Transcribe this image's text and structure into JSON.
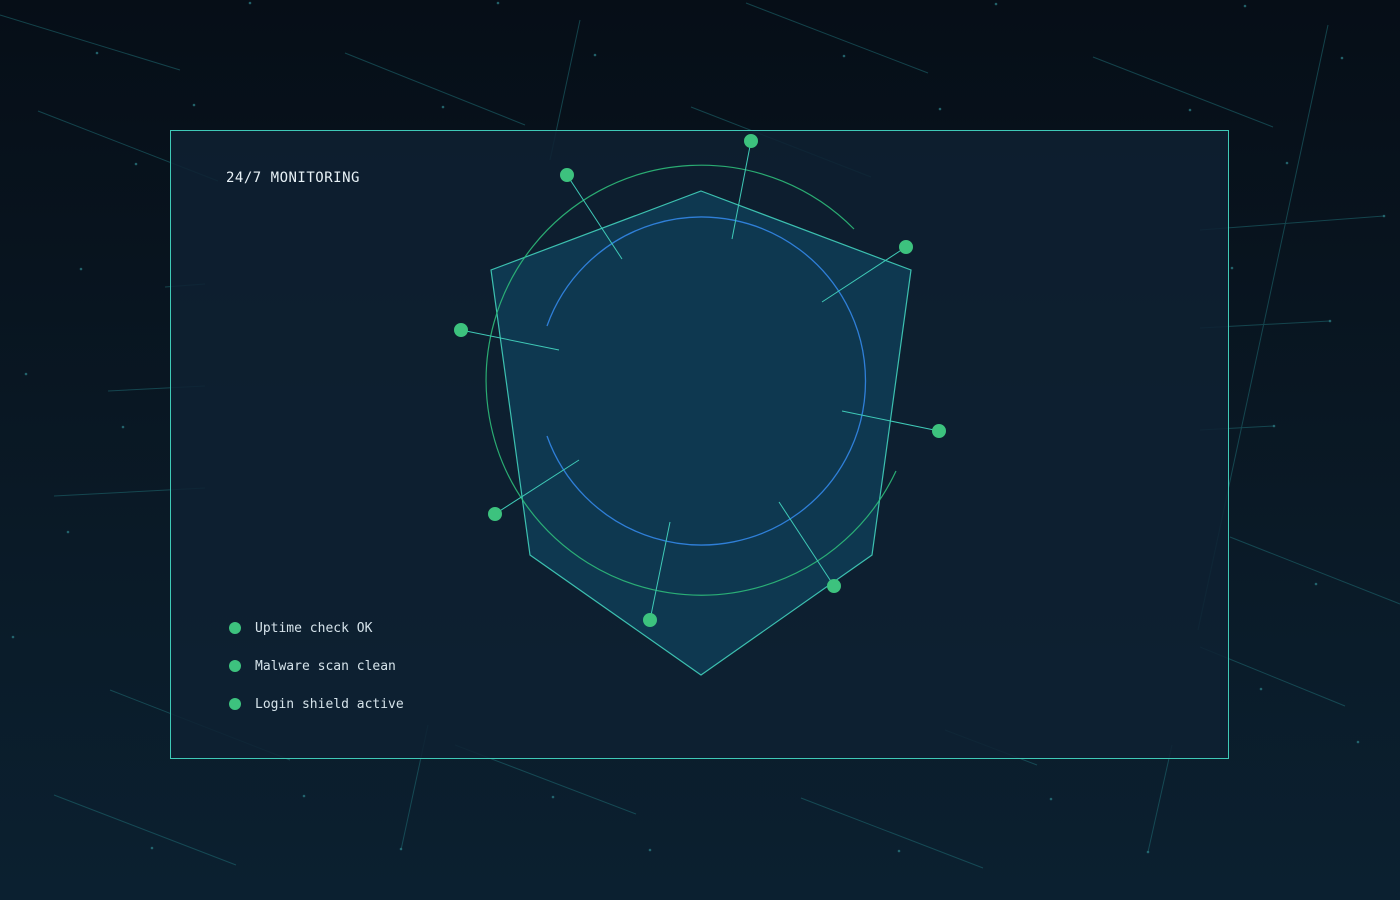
{
  "panel": {
    "title": "24/7 MONITORING"
  },
  "status_items": [
    {
      "label": "Uptime check OK",
      "state": "ok"
    },
    {
      "label": "Malware scan clean",
      "state": "ok"
    },
    {
      "label": "Login shield active",
      "state": "ok"
    }
  ],
  "colors": {
    "accent": "#3fc9b7",
    "status_ok": "#3dc27e",
    "shield_fill": "#0f3a52",
    "ring_inner": "#2f7fd8",
    "ring_outer": "#2dbb7a",
    "background": "#07121c"
  },
  "icons": {
    "status": "status-dot-icon",
    "shield": "shield-icon",
    "node": "network-node-icon"
  }
}
